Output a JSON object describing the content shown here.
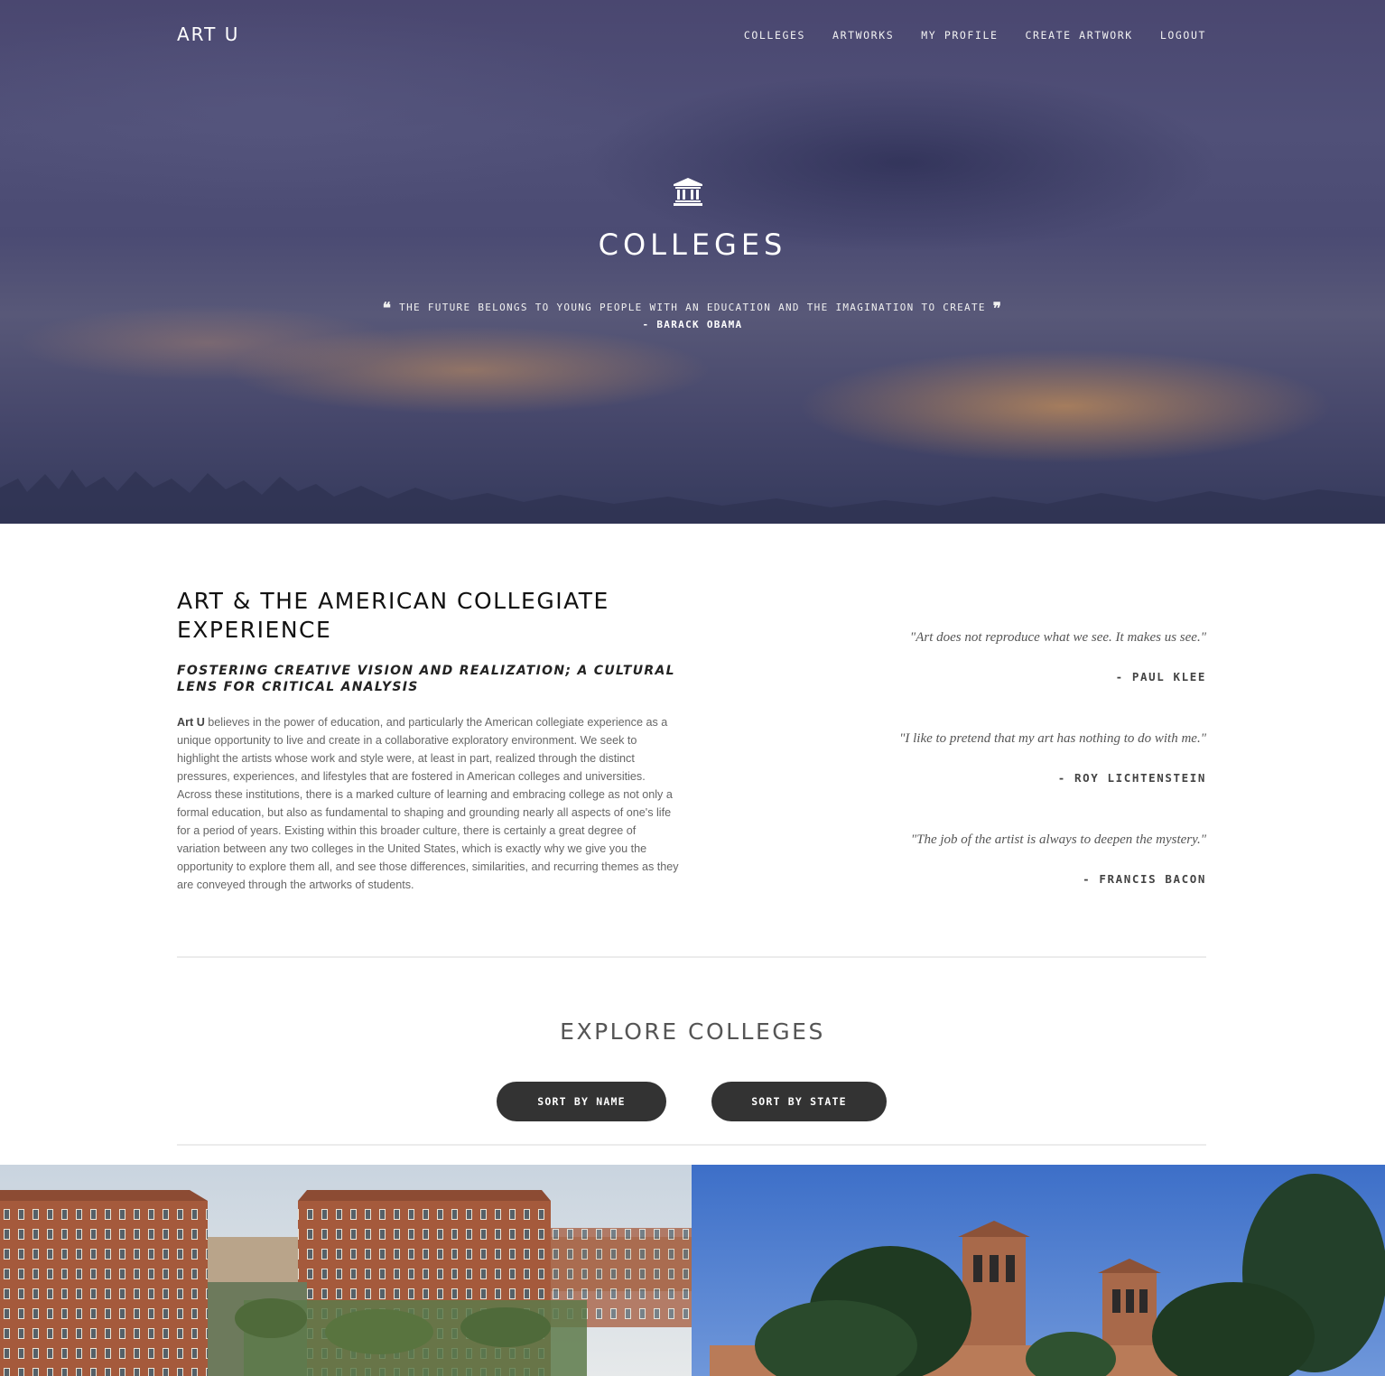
{
  "nav": {
    "brand": "ART U",
    "links": [
      "COLLEGES",
      "ARTWORKS",
      "MY PROFILE",
      "CREATE ARTWORK",
      "LOGOUT"
    ]
  },
  "hero": {
    "icon": "institution-icon",
    "title": "COLLEGES",
    "quote": "THE FUTURE BELONGS TO YOUNG PEOPLE WITH AN EDUCATION AND THE IMAGINATION TO CREATE",
    "author": "- BARACK OBAMA"
  },
  "about": {
    "heading": "ART & THE AMERICAN COLLEGIATE EXPERIENCE",
    "subheading": "FOSTERING CREATIVE VISION AND REALIZATION; A CULTURAL LENS FOR CRITICAL ANALYSIS",
    "body_strong": "Art U",
    "body": " believes in the power of education, and particularly the American collegiate experience as a unique opportunity to live and create in a collaborative exploratory environment. We seek to highlight the artists whose work and style were, at least in part, realized through the distinct pressures, experiences, and lifestyles that are fostered in American colleges and universities. Across these institutions, there is a marked culture of learning and embracing college as not only a formal education, but also as fundamental to shaping and grounding nearly all aspects of one's life for a period of years. Existing within this broader culture, there is certainly a great degree of variation between any two colleges in the United States, which is exactly why we give you the opportunity to explore them all, and see those differences, similarities, and recurring themes as they are conveyed through the artworks of students."
  },
  "quotes": [
    {
      "text": "\"Art does not reproduce what we see. It makes us see.\"",
      "author": "- PAUL KLEE"
    },
    {
      "text": "\"I like to pretend that my art has nothing to do with me.\"",
      "author": "- ROY LICHTENSTEIN"
    },
    {
      "text": "\"The job of the artist is always to deepen the mystery.\"",
      "author": "- FRANCIS BACON"
    }
  ],
  "explore": {
    "title": "EXPLORE COLLEGES",
    "sort_name": "SORT BY NAME",
    "sort_state": "SORT BY STATE"
  }
}
